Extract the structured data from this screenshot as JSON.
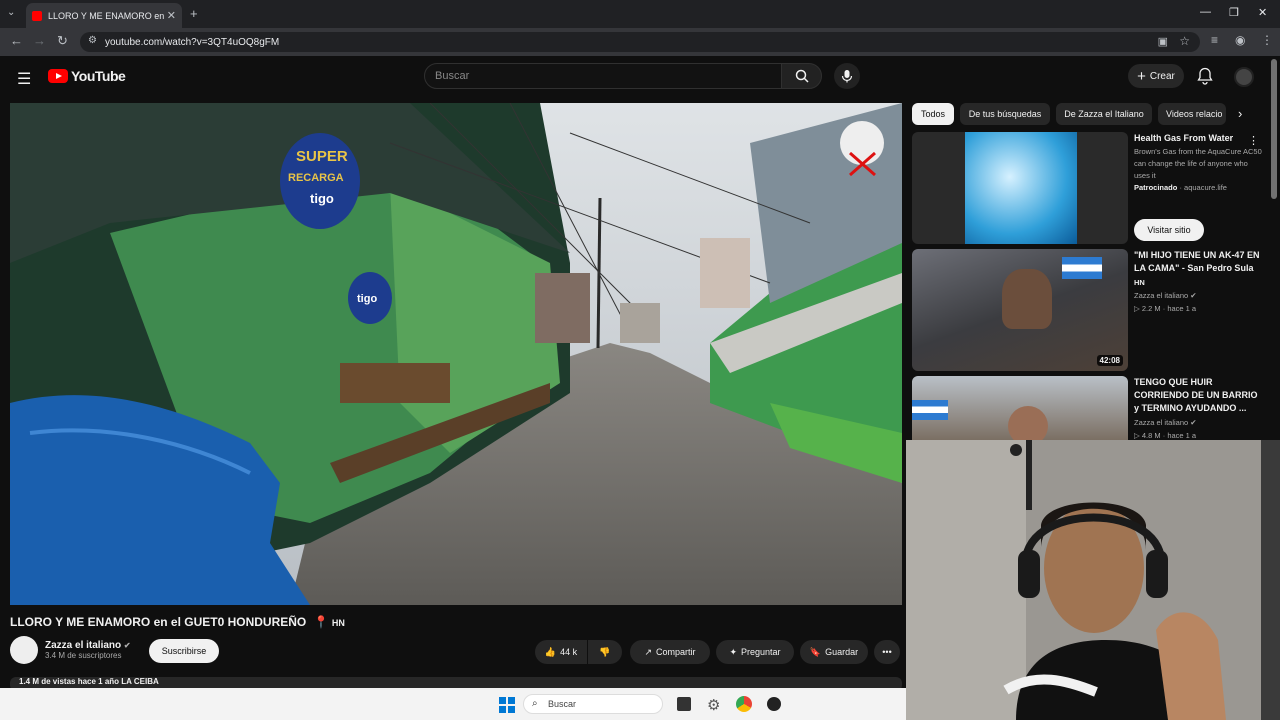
{
  "browser": {
    "tab_title": "LLORO Y ME ENAMORO en el GUETO HONDUREÑO",
    "url": "youtube.com/watch?v=3QT4uOQ8gFM"
  },
  "header": {
    "logo_text": "YouTube",
    "search_placeholder": "Buscar",
    "create_label": "Crear"
  },
  "video": {
    "title": "LLORO Y ME ENAMORO en el GUET0 HONDUREÑO",
    "flag_tag": "HN",
    "channel_name": "Zazza el italiano",
    "subscribers": "3.4 M de suscriptores",
    "subscribe_label": "Suscribirse",
    "likes": "44 k",
    "share_label": "Compartir",
    "ask_label": "Preguntar",
    "save_label": "Guardar",
    "views_line": "1.4 M de vistas  hace 1 año  LA CEIBA",
    "sign_line1": "SUPER",
    "sign_line2": "RECARGA",
    "sign_brand": "tigo",
    "sign_brand2": "tigo"
  },
  "chips": [
    "Todos",
    "De tus búsquedas",
    "De Zazza el Italiano",
    "Videos relacio"
  ],
  "recommendations": [
    {
      "title": "Health Gas From Water",
      "desc": "Brown's Gas from the AquaCure AC50 can change the life of anyone who uses it",
      "sponsor": "Patrocinado",
      "sponsor_domain": "· aquacure.life",
      "cta": "Visitar sitio"
    },
    {
      "title": "\"MI HIJO TIENE UN AK-47 EN LA CAMA\" - San Pedro Sula",
      "tag": "HN",
      "channel": "Zazza el italiano",
      "views": "2.2 M",
      "age": "hace 1 a",
      "duration": "42:08"
    },
    {
      "title": "TENGO QUE HUIR CORRIENDO DE UN BARRIO y TERMINO AYUDANDO ...",
      "channel": "Zazza el italiano",
      "views": "4.8 M",
      "age": "hace 1 a"
    }
  ],
  "taskbar": {
    "search_placeholder": "Buscar"
  },
  "colors": {
    "brand_red": "#ff0000",
    "background": "#0f0f0f",
    "chip_active": "#f1f1f1"
  }
}
